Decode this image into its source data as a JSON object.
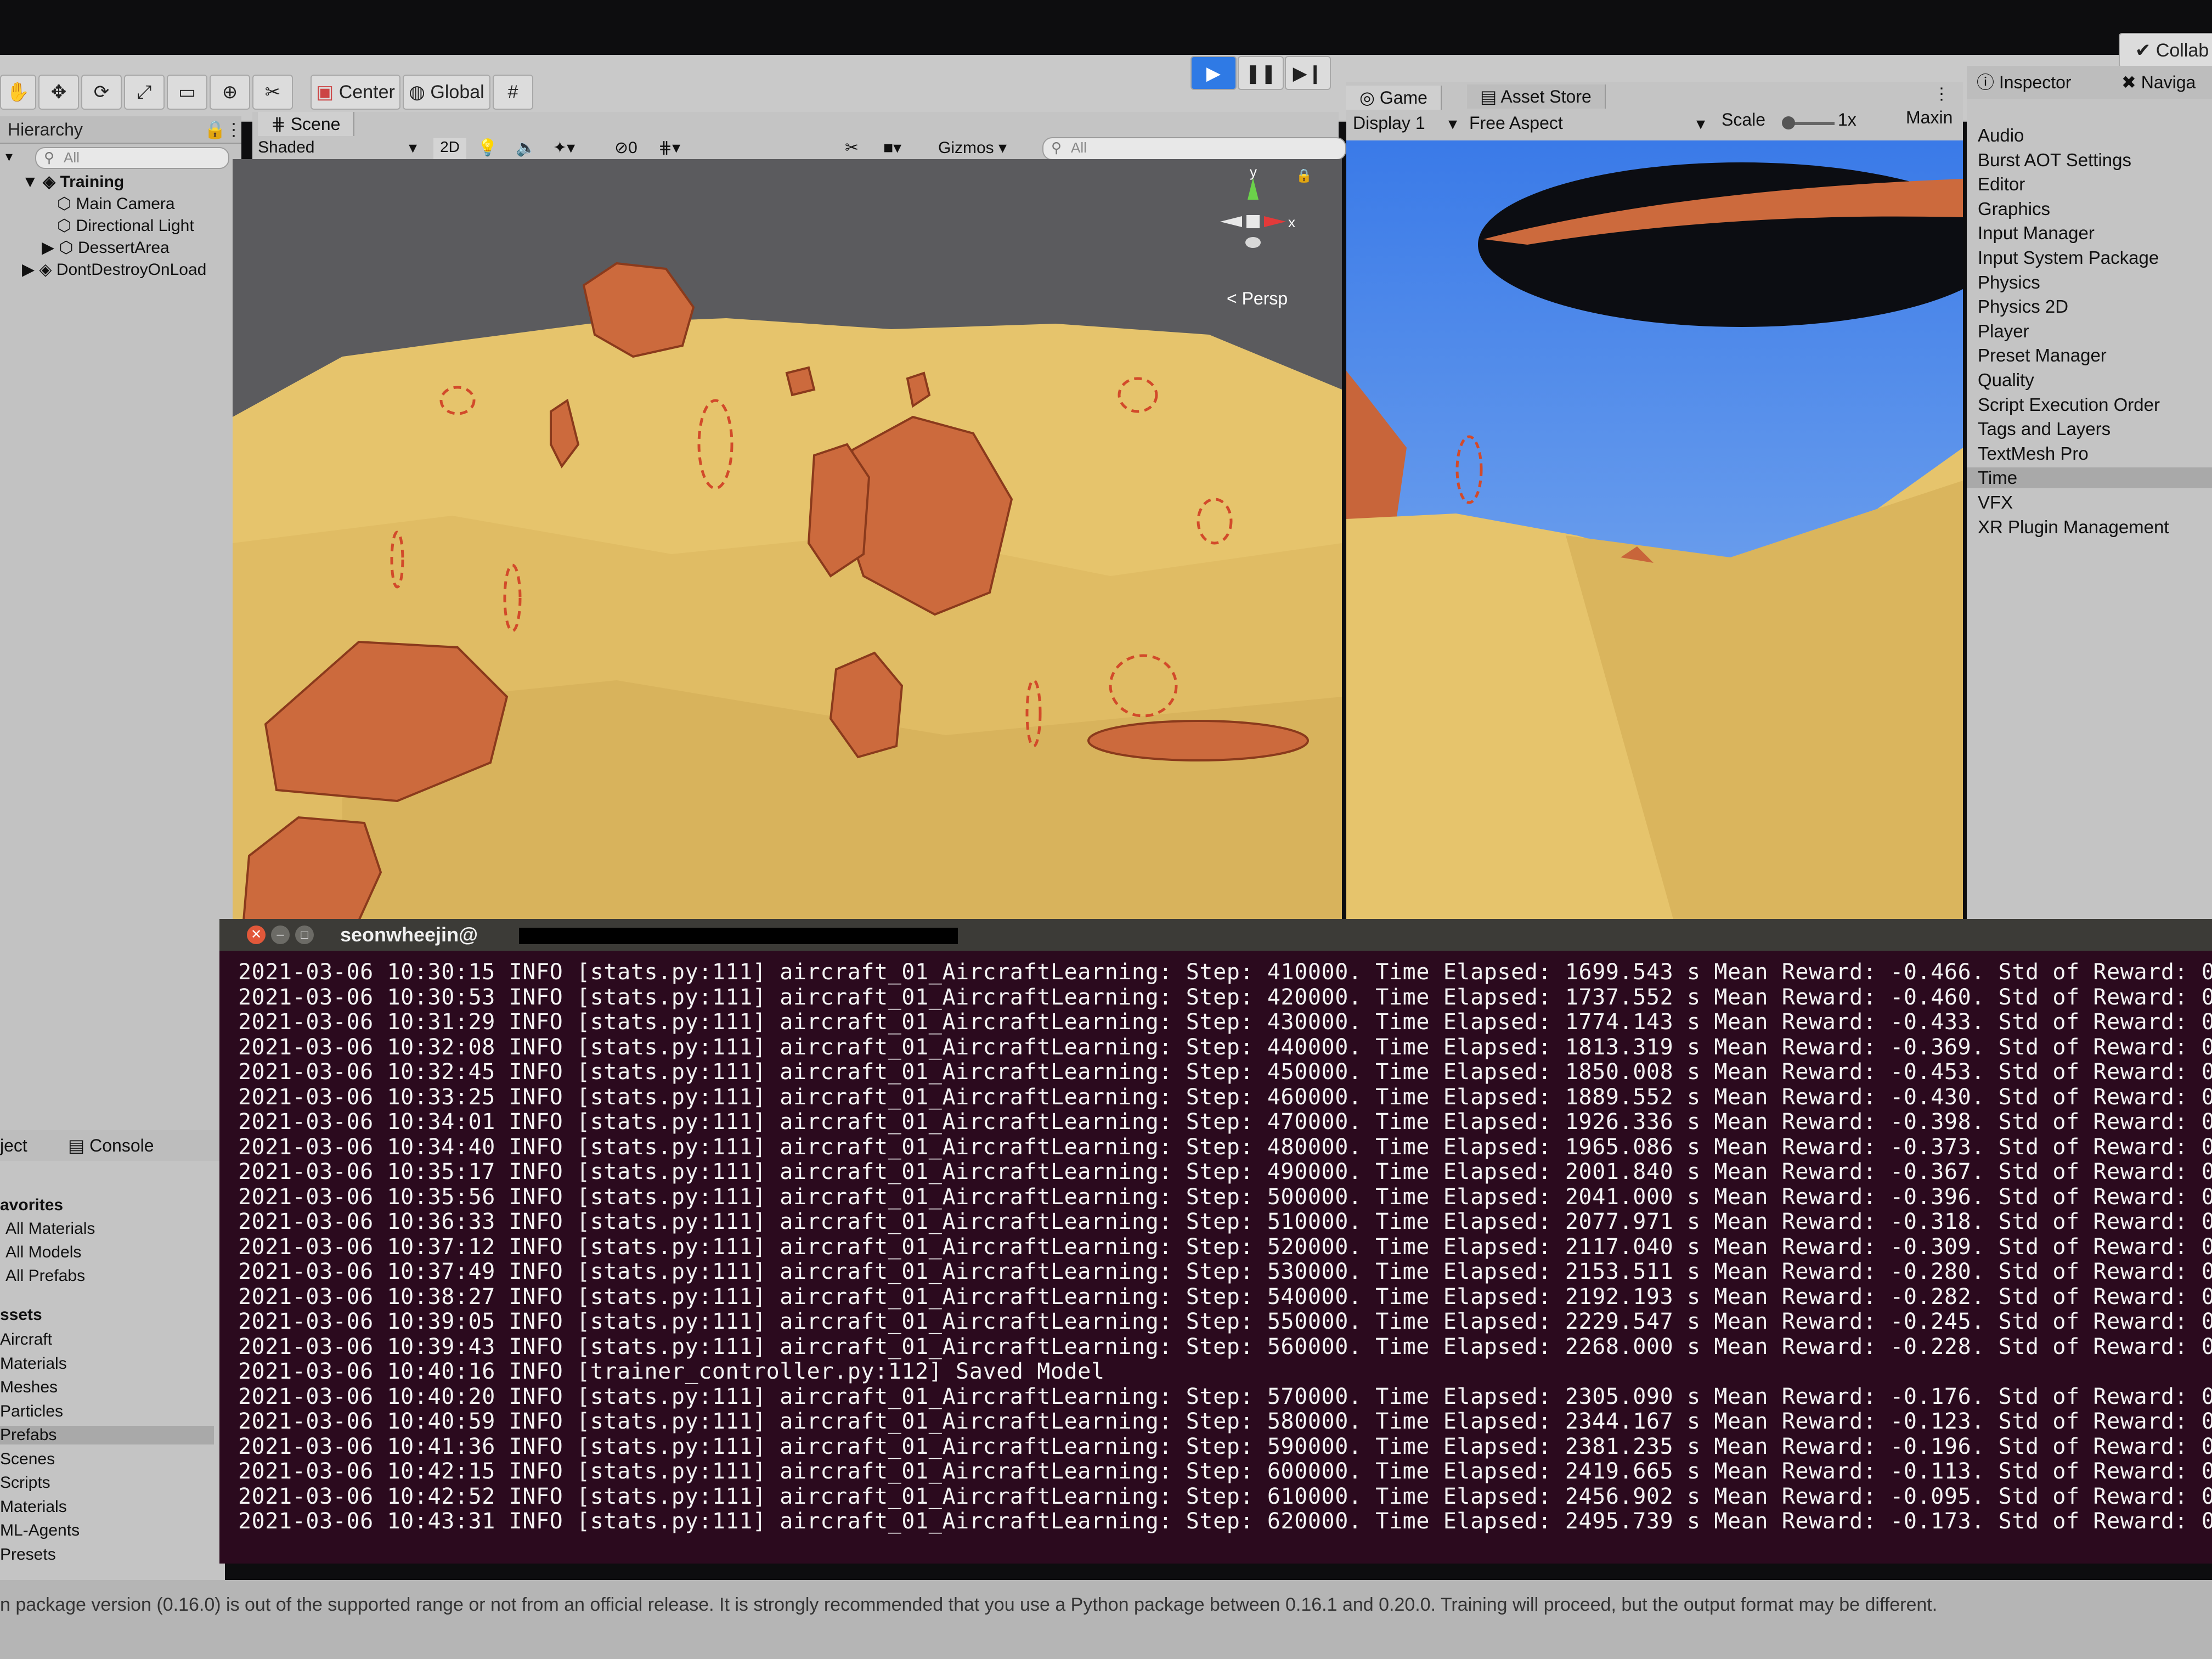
{
  "toolbar": {
    "pivot_label": "Center",
    "space_label": "Global",
    "collab_label": "Collab"
  },
  "hierarchy": {
    "title": "Hierarchy",
    "search_placeholder": "All",
    "items": [
      {
        "label": "Training"
      },
      {
        "label": "Main Camera"
      },
      {
        "label": "Directional Light"
      },
      {
        "label": "DessertArea"
      },
      {
        "label": "DontDestroyOnLoad"
      }
    ]
  },
  "scene": {
    "tab_label": "Scene",
    "shading_mode": "Shaded",
    "mode_2d": "2D",
    "hidden_count": "0",
    "gizmos_label": "Gizmos",
    "search_placeholder": "All",
    "persp_label": "< Persp",
    "axis_y": "y",
    "axis_x": "x"
  },
  "game": {
    "tab_label": "Game",
    "asset_store_label": "Asset Store",
    "display_label": "Display 1",
    "aspect_label": "Free Aspect",
    "scale_label": "Scale",
    "scale_value": "1x",
    "maximize_label": "Maxin"
  },
  "inspector": {
    "tab_label": "Inspector",
    "navigation_label": "Naviga",
    "items": [
      "Audio",
      "Burst AOT Settings",
      "Editor",
      "Graphics",
      "Input Manager",
      "Input System Package",
      "Physics",
      "Physics 2D",
      "Player",
      "Preset Manager",
      "Quality",
      "Script Execution Order",
      "Tags and Layers",
      "TextMesh Pro",
      "Time",
      "VFX",
      "XR Plugin Management"
    ],
    "selected_item": "Time"
  },
  "project": {
    "project_tab": "ject",
    "console_tab": "Console",
    "favorites_header": "avorites",
    "favorites": [
      "All Materials",
      "All Models",
      "All Prefabs"
    ],
    "assets_header": "ssets",
    "assets": [
      "Aircraft",
      "Materials",
      "Meshes",
      "Particles",
      "Prefabs",
      "Scenes",
      "Scripts",
      "Materials",
      "ML-Agents",
      "Presets"
    ],
    "selected_asset": "Prefabs"
  },
  "terminal": {
    "title": "seonwheejin@",
    "lines": [
      "2021-03-06 10:30:15 INFO [stats.py:111] aircraft_01_AircraftLearning: Step: 410000. Time Elapsed: 1699.543 s Mean Reward: -0.466. Std of Reward: 0",
      "2021-03-06 10:30:53 INFO [stats.py:111] aircraft_01_AircraftLearning: Step: 420000. Time Elapsed: 1737.552 s Mean Reward: -0.460. Std of Reward: 0",
      "2021-03-06 10:31:29 INFO [stats.py:111] aircraft_01_AircraftLearning: Step: 430000. Time Elapsed: 1774.143 s Mean Reward: -0.433. Std of Reward: 0",
      "2021-03-06 10:32:08 INFO [stats.py:111] aircraft_01_AircraftLearning: Step: 440000. Time Elapsed: 1813.319 s Mean Reward: -0.369. Std of Reward: 0",
      "2021-03-06 10:32:45 INFO [stats.py:111] aircraft_01_AircraftLearning: Step: 450000. Time Elapsed: 1850.008 s Mean Reward: -0.453. Std of Reward: 0",
      "2021-03-06 10:33:25 INFO [stats.py:111] aircraft_01_AircraftLearning: Step: 460000. Time Elapsed: 1889.552 s Mean Reward: -0.430. Std of Reward: 0",
      "2021-03-06 10:34:01 INFO [stats.py:111] aircraft_01_AircraftLearning: Step: 470000. Time Elapsed: 1926.336 s Mean Reward: -0.398. Std of Reward: 0",
      "2021-03-06 10:34:40 INFO [stats.py:111] aircraft_01_AircraftLearning: Step: 480000. Time Elapsed: 1965.086 s Mean Reward: -0.373. Std of Reward: 0",
      "2021-03-06 10:35:17 INFO [stats.py:111] aircraft_01_AircraftLearning: Step: 490000. Time Elapsed: 2001.840 s Mean Reward: -0.367. Std of Reward: 0",
      "2021-03-06 10:35:56 INFO [stats.py:111] aircraft_01_AircraftLearning: Step: 500000. Time Elapsed: 2041.000 s Mean Reward: -0.396. Std of Reward: 0",
      "2021-03-06 10:36:33 INFO [stats.py:111] aircraft_01_AircraftLearning: Step: 510000. Time Elapsed: 2077.971 s Mean Reward: -0.318. Std of Reward: 0",
      "2021-03-06 10:37:12 INFO [stats.py:111] aircraft_01_AircraftLearning: Step: 520000. Time Elapsed: 2117.040 s Mean Reward: -0.309. Std of Reward: 0",
      "2021-03-06 10:37:49 INFO [stats.py:111] aircraft_01_AircraftLearning: Step: 530000. Time Elapsed: 2153.511 s Mean Reward: -0.280. Std of Reward: 0",
      "2021-03-06 10:38:27 INFO [stats.py:111] aircraft_01_AircraftLearning: Step: 540000. Time Elapsed: 2192.193 s Mean Reward: -0.282. Std of Reward: 0",
      "2021-03-06 10:39:05 INFO [stats.py:111] aircraft_01_AircraftLearning: Step: 550000. Time Elapsed: 2229.547 s Mean Reward: -0.245. Std of Reward: 0",
      "2021-03-06 10:39:43 INFO [stats.py:111] aircraft_01_AircraftLearning: Step: 560000. Time Elapsed: 2268.000 s Mean Reward: -0.228. Std of Reward: 0",
      "2021-03-06 10:40:16 INFO [trainer_controller.py:112] Saved Model",
      "2021-03-06 10:40:20 INFO [stats.py:111] aircraft_01_AircraftLearning: Step: 570000. Time Elapsed: 2305.090 s Mean Reward: -0.176. Std of Reward: 0",
      "2021-03-06 10:40:59 INFO [stats.py:111] aircraft_01_AircraftLearning: Step: 580000. Time Elapsed: 2344.167 s Mean Reward: -0.123. Std of Reward: 0",
      "2021-03-06 10:41:36 INFO [stats.py:111] aircraft_01_AircraftLearning: Step: 590000. Time Elapsed: 2381.235 s Mean Reward: -0.196. Std of Reward: 0",
      "2021-03-06 10:42:15 INFO [stats.py:111] aircraft_01_AircraftLearning: Step: 600000. Time Elapsed: 2419.665 s Mean Reward: -0.113. Std of Reward: 0",
      "2021-03-06 10:42:52 INFO [stats.py:111] aircraft_01_AircraftLearning: Step: 610000. Time Elapsed: 2456.902 s Mean Reward: -0.095. Std of Reward: 0",
      "2021-03-06 10:43:31 INFO [stats.py:111] aircraft_01_AircraftLearning: Step: 620000. Time Elapsed: 2495.739 s Mean Reward: -0.173. Std of Reward: 0"
    ]
  },
  "status_bar": {
    "message": "n package version (0.16.0) is out of the supported range or not from an official release. It is strongly recommended that you use a Python package between 0.16.1 and 0.20.0. Training will proceed, but the output format may be different."
  },
  "colors": {
    "sand": "#e9c66e",
    "rock": "#c8653a",
    "sky": "#3f86f0",
    "terminal_bg": "#2b0a1e",
    "play_accent": "#1f6fe0"
  },
  "icons": [
    "hand-tool-icon",
    "move-tool-icon",
    "rotate-tool-icon",
    "scale-tool-icon",
    "rect-tool-icon",
    "transform-tool-icon",
    "custom-tool-icon",
    "play-icon",
    "pause-icon",
    "step-icon",
    "scene-gizmo-icon",
    "lock-icon",
    "terminal-close-icon",
    "terminal-minimize-icon",
    "terminal-maximize-icon"
  ]
}
